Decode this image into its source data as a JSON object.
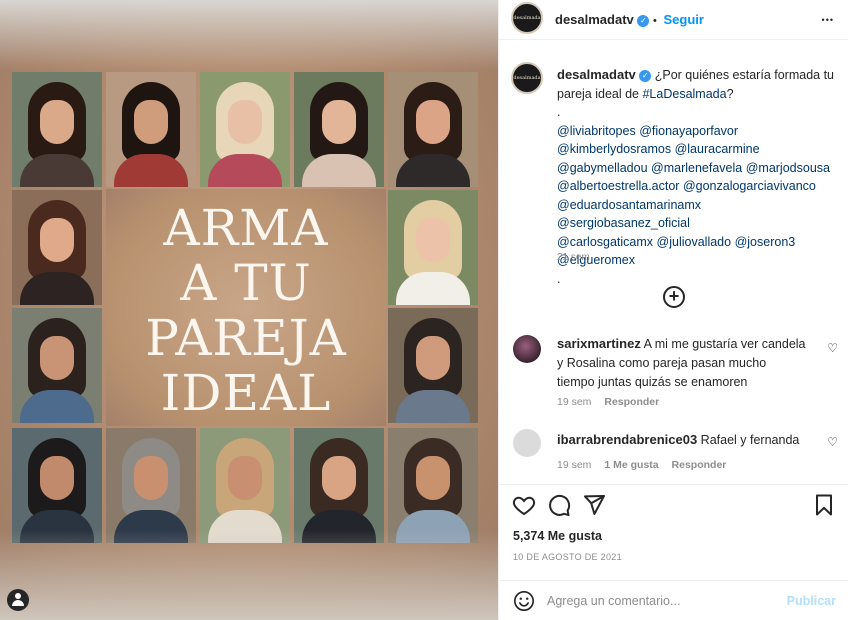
{
  "post": {
    "media_title_lines": [
      "ARMA",
      "A TU",
      "PAREJA",
      "IDEAL"
    ],
    "avatar_label": "desalmada"
  },
  "header": {
    "username": "desalmadatv",
    "separator": "•",
    "follow_label": "Seguir",
    "more_label": "•••"
  },
  "caption": {
    "username": "desalmadatv",
    "text_before_hashtag": "¿Por quiénes estaría formada tu pareja ideal de ",
    "hashtag": "#LaDesalmada",
    "text_after_hashtag": "?",
    "dot1": ".",
    "mentions": [
      "@liviabritopes",
      "@fionayaporfavor",
      "@kimberlydosramos",
      "@lauracarmine",
      "@gabymelladou",
      "@marlenefavela",
      "@marjodsousa",
      "@albertoestrella.actor",
      "@gonzalogarciavivanco",
      "@eduardosantamarinamx",
      "@sergiobasanez_oficial",
      "@carlosgaticamx",
      "@juliovallado",
      "@joseron3",
      "@elgueromex"
    ],
    "dot2": ".",
    "time": "21 sem"
  },
  "load_more": "+",
  "comments": [
    {
      "username": "sarixmartinez",
      "text": "A mi me gustaría ver candela y Rosalina como pareja pasan mucho tiempo juntas quizás se enamoren",
      "time": "19 sem",
      "reply": "Responder"
    },
    {
      "username": "ibarrabrendabrenice03",
      "text": "Rafael y fernanda",
      "time": "19 sem",
      "likes": "1 Me gusta",
      "reply": "Responder"
    }
  ],
  "likes": "5,374 Me gusta",
  "date": "10 DE AGOSTO DE 2021",
  "composer": {
    "placeholder": "Agrega un comentario...",
    "publish": "Publicar"
  },
  "colors": {
    "link": "#00376b",
    "follow": "#0095f6",
    "publish_disabled": "#b2dffc",
    "muted": "#8e8e8e"
  }
}
